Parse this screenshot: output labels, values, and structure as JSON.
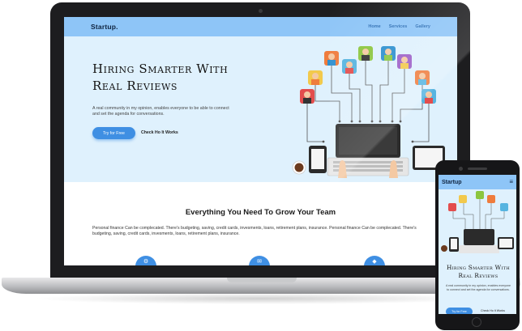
{
  "site": {
    "brand": "Startup",
    "brand_dot": ".",
    "nav": [
      "Home",
      "Services",
      "Gallery"
    ]
  },
  "hero": {
    "title": "Hiring Smarter With Real Reviews",
    "text": "A real community in my opinion, enables everyone to be able to connect and set the agenda for conversations.",
    "primary_button": "Try for Free",
    "secondary_link": "Check Ho It Works"
  },
  "features": {
    "title": "Everything You Need To Grow Your Team",
    "text": "Personal finance Can be complecated. There's budgeting, saving, credit cards, invesments, loans, retirement plans, insurance. Personal finance Can be complecated. There's budgeting, saving, credit cards, invesments, loans, retirement plans, insurance.",
    "icons": [
      "gear-icon",
      "chat-icon",
      "shield-icon"
    ]
  },
  "phone": {
    "brand": "Startup",
    "menu_icon": "≡",
    "title": "Hiring Smarter With Real Reviews",
    "text": "A real community in my opinion, enables everyone to connect and set the agenda for conversations.",
    "primary_button": "Try for Free",
    "secondary_link": "Check Ho It Works"
  },
  "colors": {
    "nav": "#8ec5f7",
    "hero_bg": "#dff1fd",
    "accent": "#3f8fe3",
    "frame": "#1d1d1f"
  }
}
